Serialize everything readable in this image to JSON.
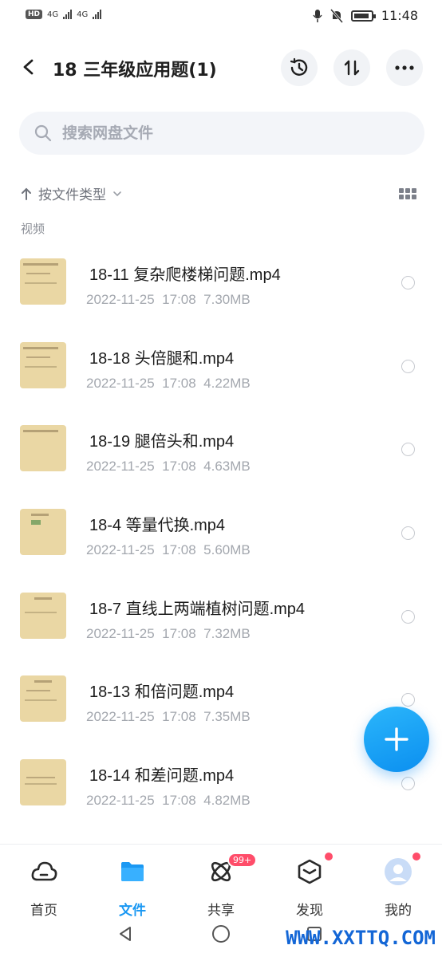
{
  "status": {
    "time": "11:48",
    "net1": "4G",
    "net2": "4G",
    "hd": "HD"
  },
  "header": {
    "title": "18 三年级应用题(1)"
  },
  "search": {
    "placeholder": "搜索网盘文件"
  },
  "sort": {
    "label": "按文件类型"
  },
  "section": {
    "label": "视频"
  },
  "files": [
    {
      "name": "18-11 复杂爬楼梯问题.mp4",
      "date": "2022-11-25",
      "time": "17:08",
      "size": "7.30MB"
    },
    {
      "name": "18-18 头倍腿和.mp4",
      "date": "2022-11-25",
      "time": "17:08",
      "size": "4.22MB"
    },
    {
      "name": "18-19 腿倍头和.mp4",
      "date": "2022-11-25",
      "time": "17:08",
      "size": "4.63MB"
    },
    {
      "name": "18-4 等量代换.mp4",
      "date": "2022-11-25",
      "time": "17:08",
      "size": "5.60MB"
    },
    {
      "name": "18-7 直线上两端植树问题.mp4",
      "date": "2022-11-25",
      "time": "17:08",
      "size": "7.32MB"
    },
    {
      "name": "18-13 和倍问题.mp4",
      "date": "2022-11-25",
      "time": "17:08",
      "size": "7.35MB"
    },
    {
      "name": "18-14 和差问题.mp4",
      "date": "2022-11-25",
      "time": "17:08",
      "size": "4.82MB"
    }
  ],
  "nav": [
    {
      "label": "首页",
      "icon": "cloud-home-icon"
    },
    {
      "label": "文件",
      "icon": "folder-icon",
      "active": true
    },
    {
      "label": "共享",
      "icon": "share-icon",
      "badge": "99+"
    },
    {
      "label": "发现",
      "icon": "discover-box-icon"
    },
    {
      "label": "我的",
      "icon": "avatar-icon"
    }
  ],
  "watermark": "WWW.XXTTQ.COM",
  "colors": {
    "accent": "#1a98f3",
    "badge": "#ff4d6a",
    "thumb": "#ead7a4"
  }
}
